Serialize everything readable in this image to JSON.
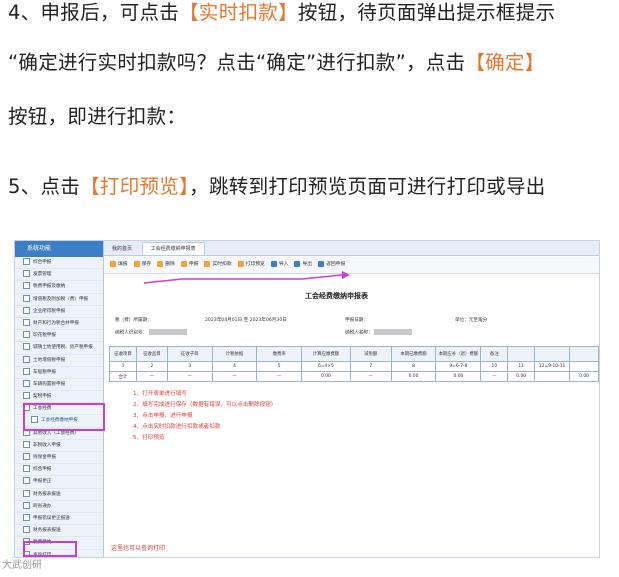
{
  "paragraphs": {
    "p1": {
      "pre": "4、申报后，可点击",
      "hl1": "【实时扣款】",
      "post": "按钮，待页面弹出提示框提示"
    },
    "p2": {
      "pre": "“确定进行实时扣款吗？点击“确定”进行扣款”，点击",
      "hl1": "【确定】"
    },
    "p3": {
      "text": "按钮，即进行扣款："
    },
    "p4": {
      "pre": "5、点击",
      "hl1": "【打印预览】",
      "post": "，跳转到打印预览页面可进行打印或导出"
    }
  },
  "screenshot": {
    "sidebar_title": "系统功能",
    "sidebar_items": [
      "综合申报",
      "发票管理",
      "税费申报及缴纳",
      "增值税及附加税（费）申报",
      "企业所得税申报",
      "财产和行为税合并申报",
      "印花税申报",
      "城镇土地使用税、房产税申报",
      "土地增值税申报",
      "车船税申报",
      "车辆购置税申报",
      "契税申报",
      "工会经费"
    ],
    "sidebar_sub": "工会经费缴纳申报",
    "sidebar_items_after": [
      "其他收入（工会经费）",
      "非税收入申报",
      "残保金申报",
      "综合申报",
      "申报更正",
      "财务报表报送",
      "跨省通办",
      "申报错误更正报送",
      "财务报表报送",
      "税费缴纳"
    ],
    "sidebar_bottom": "查询打印",
    "sidebar_note": "这里也可以查询打印",
    "tabs": [
      "我的首页",
      "工会经费缴纳申报表"
    ],
    "toolbar": [
      "填报",
      "保存",
      "删除",
      "申报",
      "实时扣款",
      "打印预览",
      "导入",
      "导出",
      "返回申报"
    ],
    "form_title": "工会经费缴纳申报表",
    "meta": {
      "period_label": "税（费）所属期：",
      "period_value": "2023年04月01日 至 2023年06月30日",
      "date_label": "申报日期：",
      "unit_label": "单位：元至角分",
      "taxpayer_label": "纳税人识别号：",
      "name_label": "纳税人名称："
    },
    "table": {
      "headers": [
        "征收项目",
        "征收品目",
        "征收子目",
        "计税依据",
        "缴费率",
        "计算应缴费额",
        "减免额",
        "本期已缴费额",
        "本期应补（退）费额",
        "备注",
        "",
        "",
        ""
      ],
      "row1": [
        "1",
        "2",
        "3",
        "4",
        "5",
        "6=4×5",
        "7",
        "8",
        "9=6-7-8",
        "10",
        "11",
        "12=9-10-11",
        ""
      ],
      "row2": [
        "合计",
        "—",
        "—",
        "—",
        "—",
        "0.00",
        "—",
        "0.00",
        "0.00",
        "—",
        "0.00",
        "",
        "0.00"
      ]
    },
    "steps": [
      "1、打开表单进行填写",
      "2、填写完成进行保存（数据有错误，可以点击删除按钮）",
      "3、点击申报，进行申报",
      "4、点击实时扣款进行扣款或者扣款",
      "5、打印预览"
    ]
  },
  "watermark": "大武创研"
}
